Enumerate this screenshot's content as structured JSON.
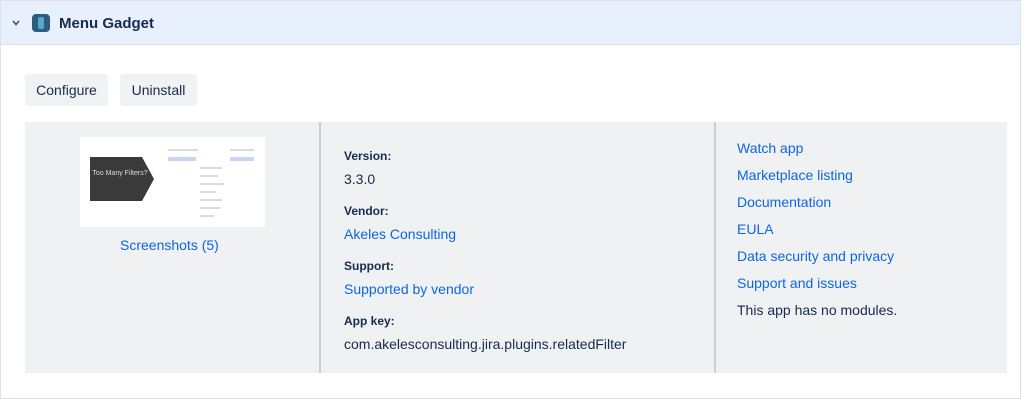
{
  "header": {
    "title": "Menu Gadget"
  },
  "actions": {
    "configure_label": "Configure",
    "uninstall_label": "Uninstall"
  },
  "screenshot": {
    "thumb_caption": "Too Many Filters?",
    "link_label": "Screenshots (5)"
  },
  "info": {
    "version_label": "Version:",
    "version": "3.3.0",
    "vendor_label": "Vendor:",
    "vendor": "Akeles Consulting",
    "support_label": "Support:",
    "support": "Supported by vendor",
    "app_key_label": "App key:",
    "app_key": "com.akelesconsulting.jira.plugins.relatedFilter"
  },
  "links": {
    "items": [
      "Watch app",
      "Marketplace listing",
      "Documentation",
      "EULA",
      "Data security and privacy",
      "Support and issues"
    ],
    "no_modules": "This app has no modules."
  },
  "colors": {
    "header_bg": "#e9f0fd",
    "link": "#0c66e4",
    "details_bg": "#f0f1f3",
    "text": "#172b4d"
  },
  "icons": {
    "collapse": "chevron-down-icon",
    "app": "app-icon"
  }
}
